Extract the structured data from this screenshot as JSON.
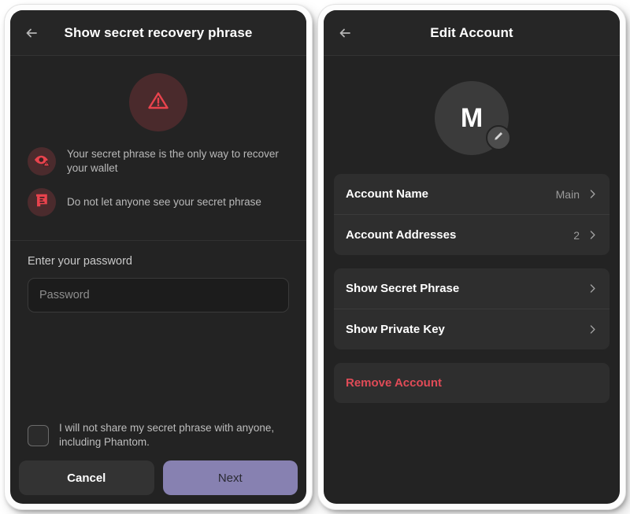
{
  "theme": {
    "panel_bg": "#232323",
    "header_bg": "#262626",
    "card_bg": "#2e2e2e",
    "accent_purple": "#8781b1",
    "danger_red": "#e04b57",
    "warn_circle_bg": "#4a2a2c"
  },
  "left_panel": {
    "header": {
      "title": "Show secret recovery phrase",
      "back_icon": "arrow-left-icon"
    },
    "warning_icon": "alert-triangle-icon",
    "warnings": [
      {
        "icon": "eye-warning-icon",
        "text": "Your secret phrase is the only way to recover your wallet"
      },
      {
        "icon": "secret-document-icon",
        "text": "Do not let anyone see your secret phrase"
      }
    ],
    "password": {
      "label": "Enter your password",
      "value": "",
      "placeholder": "Password"
    },
    "consent": {
      "checked": false,
      "text": "I will not share my secret phrase with anyone, including Phantom."
    },
    "buttons": {
      "cancel": "Cancel",
      "next": "Next"
    }
  },
  "right_panel": {
    "header": {
      "title": "Edit Account",
      "back_icon": "arrow-left-icon"
    },
    "avatar": {
      "initial": "M",
      "edit_icon": "pencil-icon"
    },
    "group_one": [
      {
        "label": "Account Name",
        "value": "Main",
        "chevron": "chevron-right-icon"
      },
      {
        "label": "Account Addresses",
        "value": "2",
        "chevron": "chevron-right-icon"
      }
    ],
    "group_two": [
      {
        "label": "Show Secret Phrase",
        "value": "",
        "chevron": "chevron-right-icon"
      },
      {
        "label": "Show Private Key",
        "value": "",
        "chevron": "chevron-right-icon"
      }
    ],
    "danger": {
      "label": "Remove Account"
    }
  }
}
